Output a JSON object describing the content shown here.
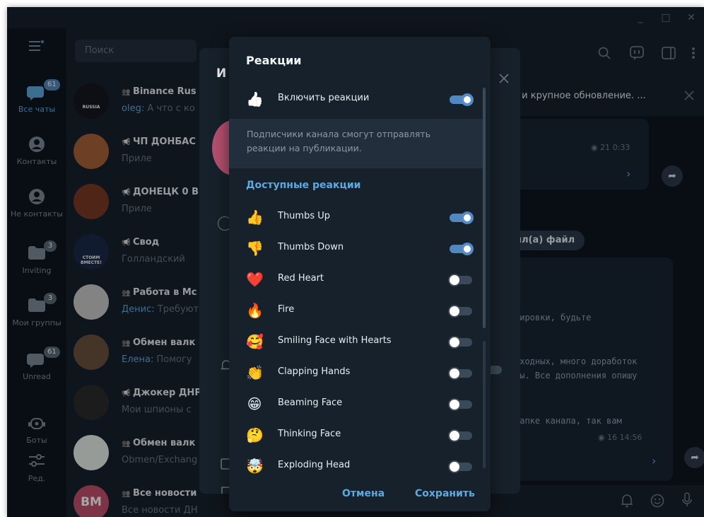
{
  "window": {
    "controls": {
      "minimize": "_",
      "maximize": "□",
      "close": "✕"
    }
  },
  "rail": {
    "items": [
      {
        "label": "Все чаты",
        "badge": "61",
        "icon": "chats-icon"
      },
      {
        "label": "Контакты",
        "badge": "",
        "icon": "person-icon"
      },
      {
        "label": "Не контакты",
        "badge": "",
        "icon": "person-icon"
      },
      {
        "label": "Inviting",
        "badge": "3",
        "icon": "folder-icon"
      },
      {
        "label": "Мои группы",
        "badge": "3",
        "icon": "folder-icon"
      },
      {
        "label": "Unread",
        "badge": "61",
        "icon": "chats-icon"
      },
      {
        "label": "Боты",
        "badge": "",
        "icon": "bot-icon"
      },
      {
        "label": "Ред.",
        "badge": "",
        "icon": "sliders-icon"
      }
    ]
  },
  "search": {
    "placeholder": "Поиск"
  },
  "chats": [
    {
      "title": "Binance Rus",
      "sender": "oleg:",
      "preview": " А что с ко",
      "type": "group",
      "avatar_color": "#14181f",
      "avatar_text": "RUSSIA"
    },
    {
      "title": "ЧП ДОНБАС",
      "sender": "",
      "preview": "Приле",
      "type": "channel",
      "avatar_color": "#a8623a",
      "avatar_text": ""
    },
    {
      "title": "ДОНЕЦК 0 В",
      "sender": "",
      "preview": "Приле",
      "type": "channel",
      "avatar_color": "#7a3a26",
      "avatar_text": ""
    },
    {
      "title": "Свод",
      "sender": "",
      "preview": "Голландский",
      "type": "channel",
      "avatar_color": "#1b2a4a",
      "avatar_text": "СТОИМ ВМЕСТЕ!"
    },
    {
      "title": "Работа в Мс",
      "sender": "Денис:",
      "preview": " Требуют",
      "type": "group",
      "avatar_color": "#c9c9c9",
      "avatar_text": ""
    },
    {
      "title": "Обмен валк",
      "sender": "Елена:",
      "preview": " Помогу",
      "type": "group",
      "avatar_color": "#6a5240",
      "avatar_text": ""
    },
    {
      "title": "Джокер ДНР",
      "sender": "",
      "preview": "Мои шпионы с",
      "type": "channel",
      "avatar_color": "#2b2b2b",
      "avatar_text": ""
    },
    {
      "title": "Обмен валк",
      "sender": "",
      "preview": "Obmen/Exchang",
      "type": "group",
      "avatar_color": "#e9efe8",
      "avatar_text": ""
    },
    {
      "title": "Все новости",
      "sender": "",
      "preview": "Все новости ДН",
      "type": "group",
      "avatar_color": "#c0506e",
      "avatar_text": "ВМ"
    }
  ],
  "main": {
    "pinned_text": "е и крупное обновление. ...",
    "msg1_meta": {
      "views": "21",
      "time": "0:33"
    },
    "file_pill": "пил(а) файл",
    "code_lines": [
      "кировки, будьте",
      "ыходных, много доработок",
      "мы. Все дополнения опишу",
      "шапке канала, так вам"
    ],
    "msg2_meta": {
      "views": "16",
      "time": "14:56"
    }
  },
  "bgdialog": {
    "title_fragment": "И"
  },
  "dialog": {
    "title": "Реакции",
    "enable": {
      "label": "Включить реакции",
      "emoji": "👍",
      "on": true
    },
    "info": "Подписчики канала смогут отправлять реакции на публикации.",
    "section_title": "Доступные реакции",
    "reactions": [
      {
        "label": "Thumbs Up",
        "emoji": "👍",
        "on": true
      },
      {
        "label": "Thumbs Down",
        "emoji": "👎",
        "on": true
      },
      {
        "label": "Red Heart",
        "emoji": "❤️",
        "on": false
      },
      {
        "label": "Fire",
        "emoji": "🔥",
        "on": false
      },
      {
        "label": "Smiling Face with Hearts",
        "emoji": "🥰",
        "on": false
      },
      {
        "label": "Clapping Hands",
        "emoji": "👏",
        "on": false
      },
      {
        "label": "Beaming Face",
        "emoji": "😁",
        "on": false
      },
      {
        "label": "Thinking Face",
        "emoji": "🤔",
        "on": false
      },
      {
        "label": "Exploding Head",
        "emoji": "🤯",
        "on": false
      }
    ],
    "cancel_label": "Отмена",
    "save_label": "Сохранить"
  },
  "colors": {
    "accent": "#5288c1",
    "link": "#5da9e0",
    "panel": "#17212b",
    "background": "#0e1621"
  }
}
